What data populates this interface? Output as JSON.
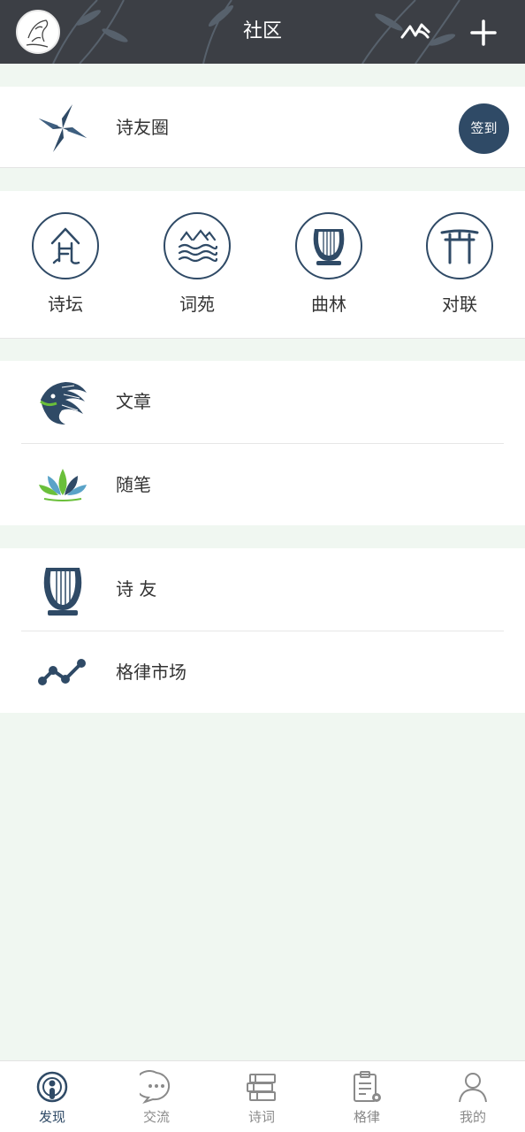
{
  "header": {
    "title": "社区"
  },
  "sections": {
    "moments": {
      "label": "诗友圈",
      "signin_label": "签到"
    },
    "categories": [
      {
        "label": "诗坛",
        "icon": "poem-altar-icon"
      },
      {
        "label": "词苑",
        "icon": "mountain-waves-icon"
      },
      {
        "label": "曲林",
        "icon": "lyre-icon"
      },
      {
        "label": "对联",
        "icon": "torii-gate-icon"
      }
    ],
    "articles": [
      {
        "label": "文章",
        "icon": "dragon-icon"
      },
      {
        "label": "随笔",
        "icon": "lotus-icon"
      }
    ],
    "community": [
      {
        "label": "诗 友",
        "icon": "lyre-icon"
      },
      {
        "label": "格律市场",
        "icon": "trend-line-icon"
      }
    ]
  },
  "bottom_nav": [
    {
      "label": "发现",
      "icon": "discover-icon",
      "active": true
    },
    {
      "label": "交流",
      "icon": "chat-bubble-icon",
      "active": false
    },
    {
      "label": "诗词",
      "icon": "books-icon",
      "active": false
    },
    {
      "label": "格律",
      "icon": "clipboard-settings-icon",
      "active": false
    },
    {
      "label": "我的",
      "icon": "user-icon",
      "active": false
    }
  ],
  "colors": {
    "header_bg": "#3c3f45",
    "accent": "#2f4a66",
    "page_bg": "#f0f7f1"
  }
}
